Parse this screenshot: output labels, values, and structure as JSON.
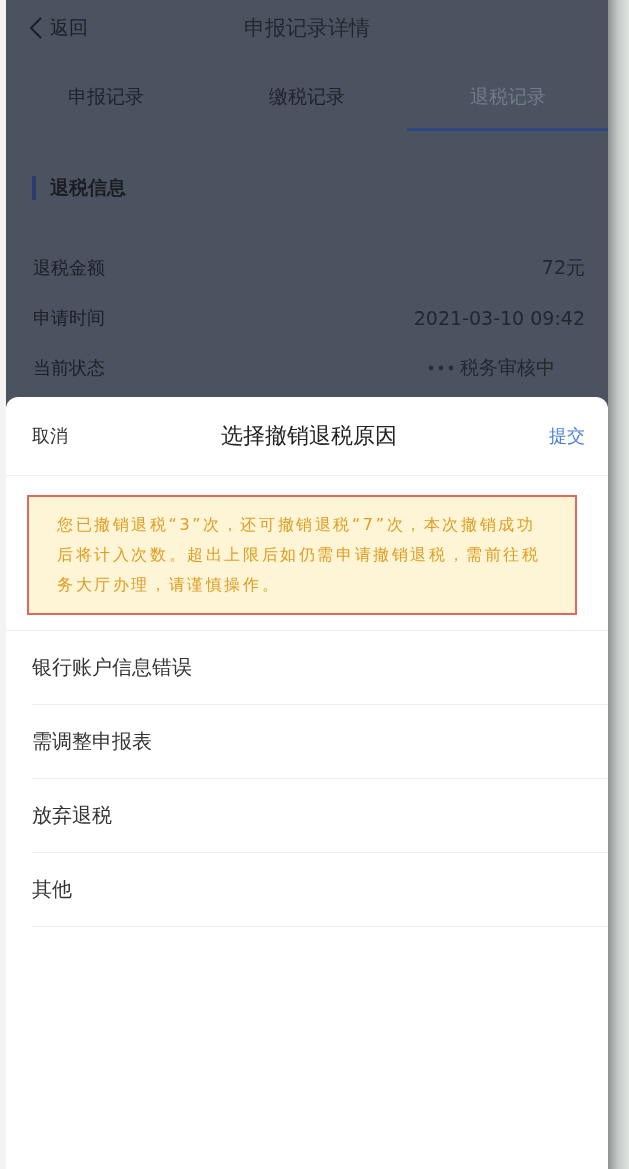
{
  "nav": {
    "back_label": "返回",
    "title": "申报记录详情"
  },
  "tabs": [
    {
      "label": "申报记录",
      "selected": false
    },
    {
      "label": "缴税记录",
      "selected": false
    },
    {
      "label": "退税记录",
      "selected": true
    }
  ],
  "section": {
    "title": "退税信息",
    "rows": [
      {
        "kind": "text",
        "label": "退税金额",
        "value": "72元"
      },
      {
        "kind": "text",
        "label": "申请时间",
        "value": "2021-03-10 09:42"
      },
      {
        "kind": "status",
        "label": "当前状态",
        "value": "税务审核中"
      }
    ]
  },
  "sheet": {
    "cancel": "取消",
    "title": "选择撤销退税原因",
    "submit": "提交",
    "warning": "您已撤销退税“3”次，还可撤销退税“7”次，本次撤销成功后将计入次数。超出上限后如仍需申请撤销退税，需前往税务大厅办理，请谨慎操作。",
    "reasons": [
      "银行账户信息错误",
      "需调整申报表",
      "放弃退税",
      "其他"
    ]
  }
}
